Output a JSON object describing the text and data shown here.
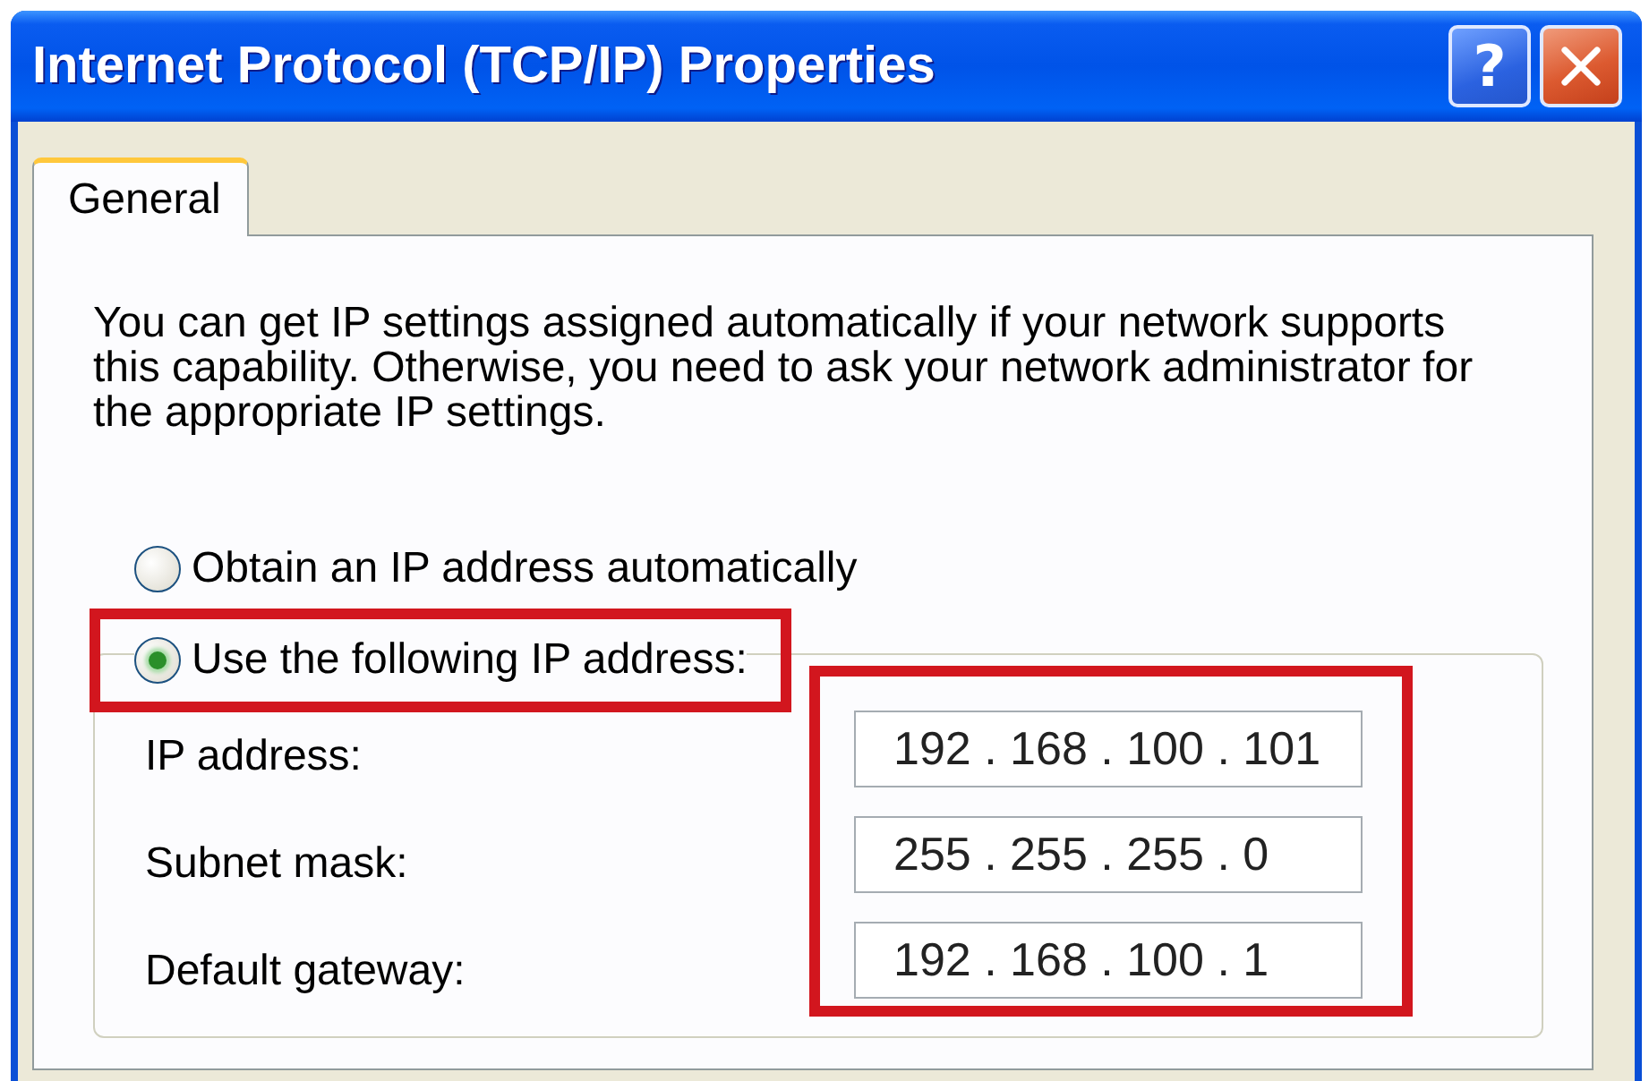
{
  "window": {
    "title": "Internet Protocol (TCP/IP) Properties",
    "title_buttons": [
      {
        "kind": "help",
        "label": "?"
      },
      {
        "kind": "close"
      }
    ]
  },
  "tabs": [
    {
      "label": "General",
      "selected": true
    }
  ],
  "description": "You can get IP settings assigned automatically if your network supports this capability. Otherwise, you need to ask your network administrator for the appropriate IP settings.",
  "ip_options": [
    {
      "label": "Obtain an IP address automatically",
      "selected": false,
      "highlighted": false
    },
    {
      "label": "Use the following IP address:",
      "selected": true,
      "highlighted": true
    }
  ],
  "address_fields": {
    "highlighted": true,
    "rows": [
      {
        "label": "IP address:",
        "value": "192 . 168 . 100 . 101"
      },
      {
        "label": "Subnet mask:",
        "value": "255 . 255 . 255 . 0"
      },
      {
        "label": "Default gateway:",
        "value": "192 . 168 . 100 . 1"
      }
    ]
  }
}
